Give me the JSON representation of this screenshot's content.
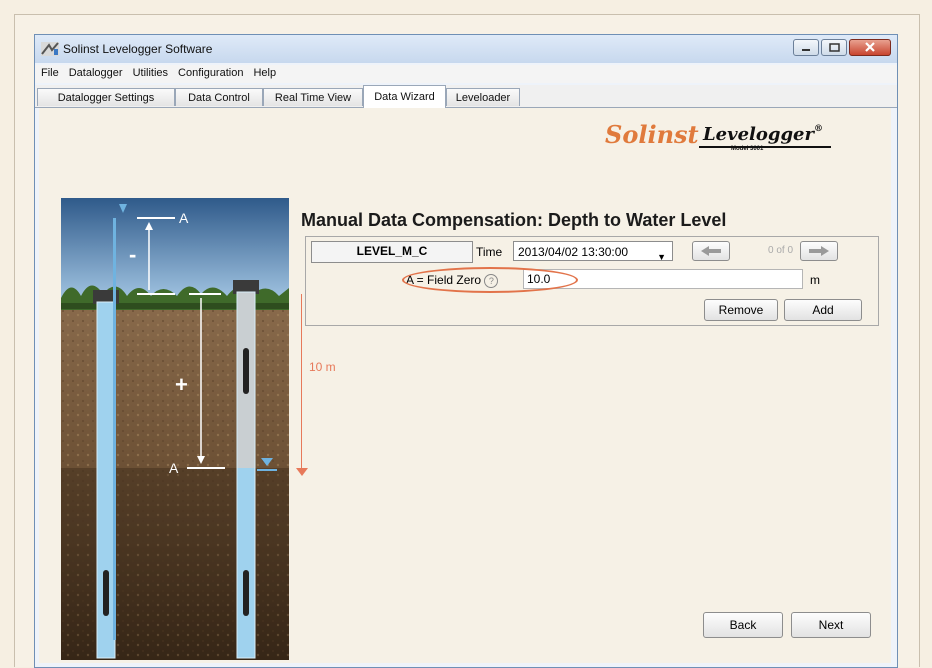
{
  "window": {
    "title": "Solinst Levelogger Software"
  },
  "menu": [
    "File",
    "Datalogger",
    "Utilities",
    "Configuration",
    "Help"
  ],
  "tabs": [
    "Datalogger Settings",
    "Data Control",
    "Real Time View",
    "Data Wizard",
    "Leveloader"
  ],
  "active_tab": "Data Wizard",
  "brand": {
    "company": "Solinst",
    "product": "Levelogger",
    "registered": "®",
    "model": "Model 3001"
  },
  "heading": "Manual Data Compensation: Depth to Water Level",
  "entry": {
    "logger_name": "LEVEL_M_C",
    "time_label": "Time",
    "time_value": "2013/04/02 13:30:00",
    "page_count": "0 of 0",
    "field_zero_label": "A = Field Zero",
    "field_zero_value": "10.0",
    "unit": "m",
    "remove_label": "Remove",
    "add_label": "Add"
  },
  "distance_label": "10 m",
  "diagram": {
    "label_a": "A",
    "minus": "-",
    "plus": "+"
  },
  "footer": {
    "back_label": "Back",
    "next_label": "Next"
  },
  "colors": {
    "accent_orange": "#e2734a",
    "window_border": "#6f8fb5",
    "water_blue": "#9fd2ee"
  }
}
